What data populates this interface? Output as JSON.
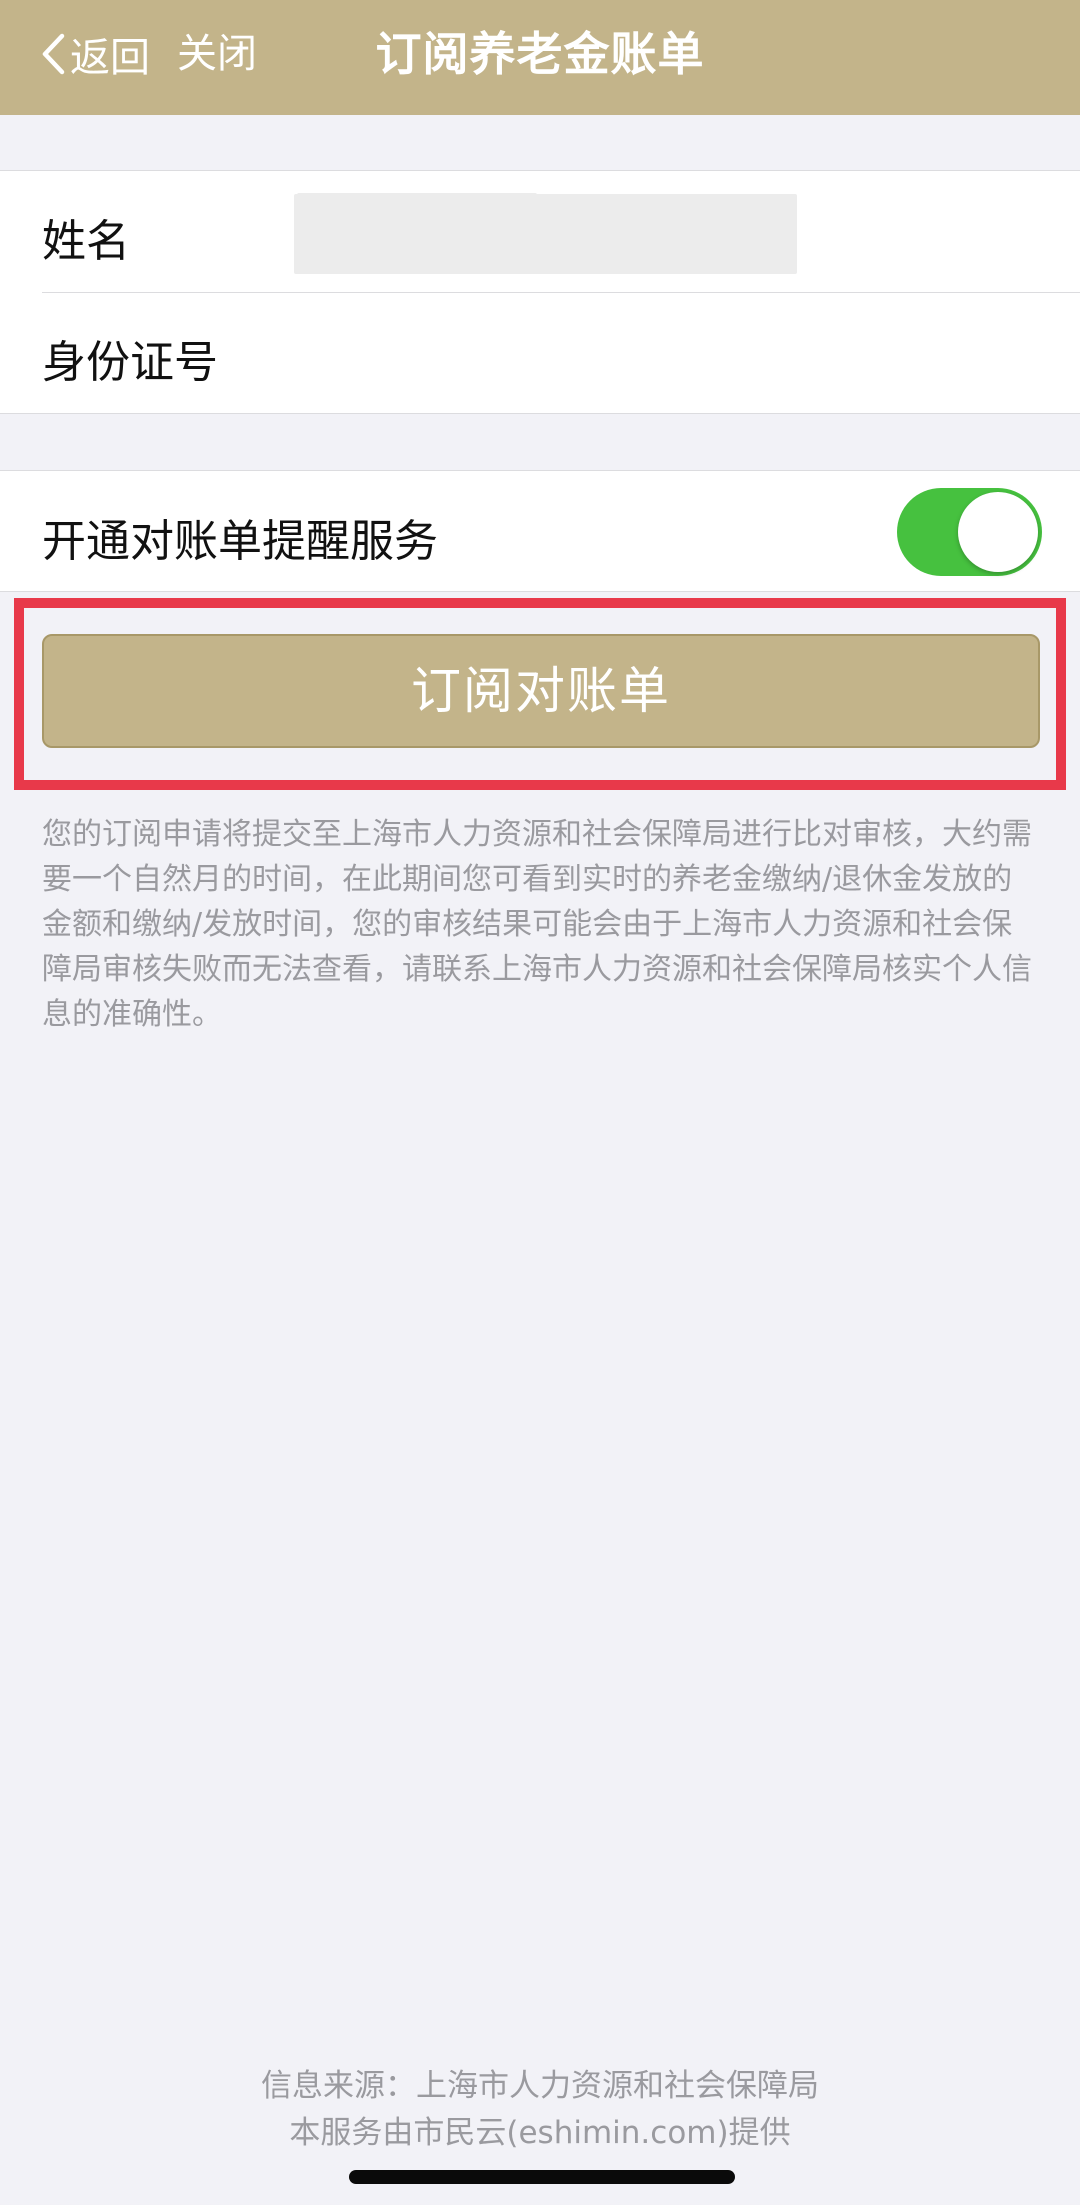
{
  "header": {
    "back_label": "返回",
    "close_label": "关闭",
    "title": "订阅养老金账单",
    "back_icon": "chevron-left-icon"
  },
  "form": {
    "name_label": "姓名",
    "id_label": "身份证号"
  },
  "reminder": {
    "label": "开通对账单提醒服务",
    "enabled": true
  },
  "subscribe_button": {
    "label": "订阅对账单"
  },
  "notice": {
    "text": "您的订阅申请将提交至上海市人力资源和社会保障局进行比对审核，大约需要一个自然月的时间，在此期间您可看到实时的养老金缴纳/退休金发放的金额和缴纳/发放时间，您的审核结果可能会由于上海市人力资源和社会保障局审核失败而无法查看，请联系上海市人力资源和社会保障局核实个人信息的准确性。"
  },
  "footer": {
    "source": "信息来源：上海市人力资源和社会保障局",
    "provider": "本服务由市民云(eshimin.com)提供"
  },
  "colors": {
    "header_bg": "#c3b48a",
    "button_bg": "#c3b48a",
    "toggle_on": "#46c13f",
    "highlight": "#e8394a",
    "page_bg": "#f2f2f7"
  }
}
